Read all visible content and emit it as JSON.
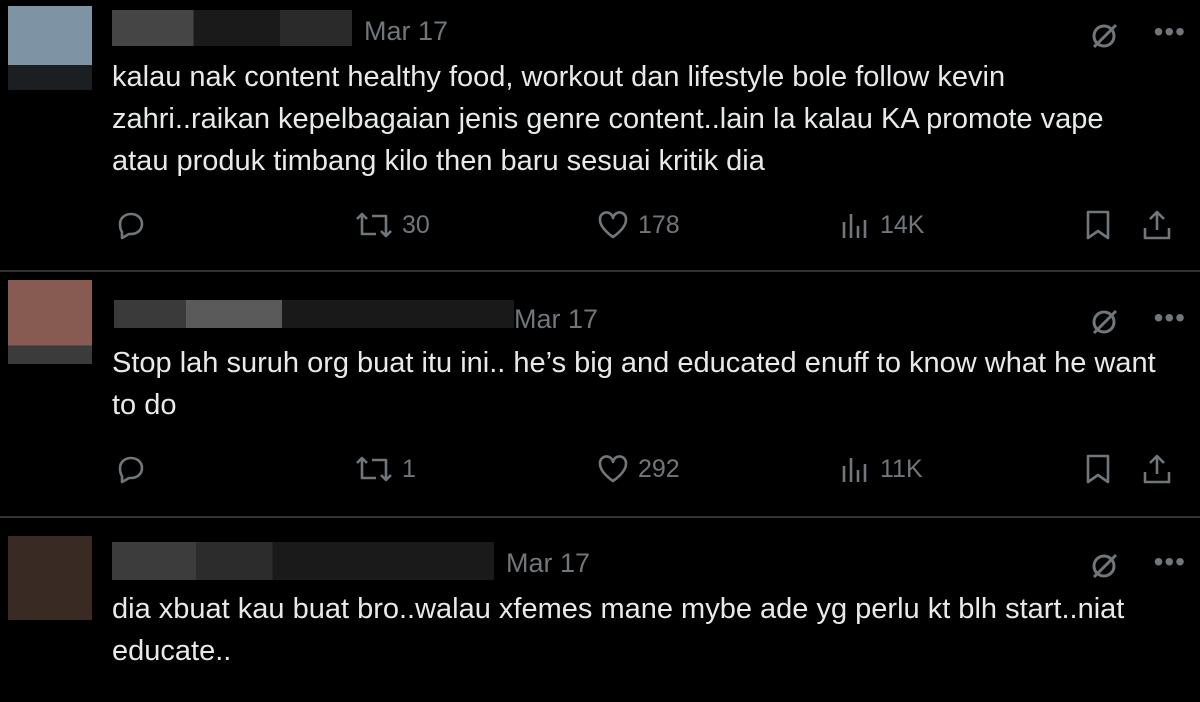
{
  "colors": {
    "background": "#000000",
    "text": "#e7e9ea",
    "muted": "#71767b",
    "divider": "#2f3336"
  },
  "tweets": [
    {
      "date": "Mar 17",
      "text": "kalau nak content healthy food, workout dan lifestyle bole follow kevin zahri..raikan kepelbagaian jenis genre content..lain la kalau KA promote vape atau produk timbang kilo then baru sesuai kritik dia",
      "retweets": "30",
      "likes": "178",
      "views": "14K"
    },
    {
      "date": "Mar 17",
      "text": "Stop lah suruh org buat itu ini.. he’s big and educated enuff to know what he want to do",
      "retweets": "1",
      "likes": "292",
      "views": "11K"
    },
    {
      "date": "Mar 17",
      "text": "dia xbuat kau buat bro..walau xfemes mane mybe ade yg perlu kt blh start..niat educate.."
    }
  ],
  "icons": {
    "reply": "reply-icon",
    "retweet": "retweet-icon",
    "like": "like-icon",
    "views": "views-icon",
    "bookmark": "bookmark-icon",
    "share": "share-icon",
    "grok": "grok-icon",
    "more": "more-icon"
  }
}
